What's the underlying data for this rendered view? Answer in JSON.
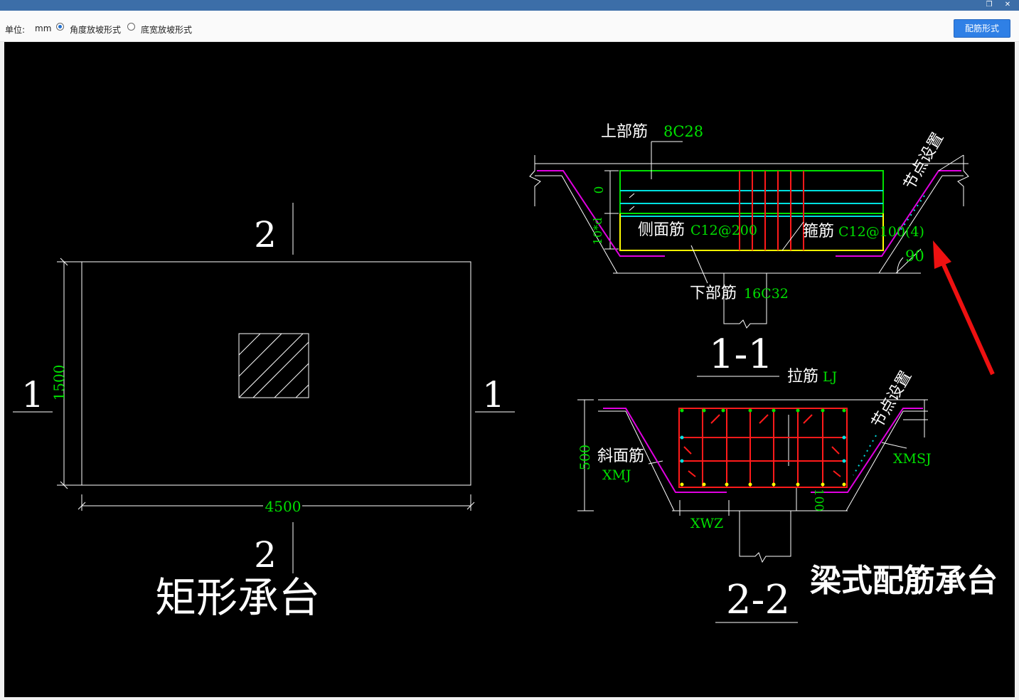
{
  "window": {
    "restore_glyph": "❐",
    "close_glyph": "✕"
  },
  "toolbar": {
    "unit_label": "单位:",
    "unit_value": "mm",
    "option_angle": "角度放坡形式",
    "option_width": "底宽放坡形式",
    "selected_option": "角度放坡形式",
    "action_button": "配筋形式"
  },
  "drawing": {
    "plan": {
      "width_dim": "4500",
      "height_dim": "1500",
      "section_1_left": "1",
      "section_1_right": "1",
      "section_2_top": "2",
      "section_2_bottom": "2",
      "caption": "矩形承台"
    },
    "section_1": {
      "top_bar_label": "上部筋",
      "top_bar_value": "8C28",
      "side_bar_label": "侧面筋",
      "side_bar_value": "C12@200",
      "stirrup_label": "箍筋",
      "stirrup_value": "C12@100(4)",
      "bottom_bar_label": "下部筋",
      "bottom_bar_value": "16C32",
      "zero_dim": "0",
      "anchor_dim": "10*d",
      "angle": "90",
      "node_setting": "节点设置",
      "title": "1-1"
    },
    "section_2": {
      "tie_label": "拉筋",
      "tie_value": "LJ",
      "slope_label": "斜面筋",
      "slope_value": "XMJ",
      "slope_side_value": "XMSJ",
      "width_value": "XWZ",
      "height_dim": "500",
      "cover_dim": "100",
      "node_setting": "节点设置",
      "title": "2-2"
    },
    "caption": "梁式配筋承台"
  },
  "colors": {
    "titlebar": "#3c6ea8",
    "button": "#2f80e6",
    "dim_green": "#00e000",
    "rebar_red": "#ff1a1a",
    "stirrup_magenta": "#e000e0",
    "cyan": "#00e0e0",
    "yellow": "#ffff00",
    "arrow_red": "#ee1111"
  }
}
